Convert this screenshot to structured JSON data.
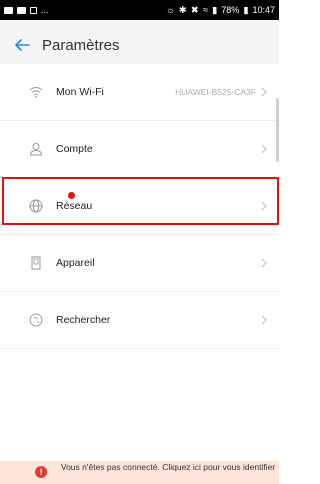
{
  "status_bar": {
    "notifications": "...",
    "battery": "78%",
    "time": "10:47"
  },
  "header": {
    "title": "Paramètres"
  },
  "list": {
    "items": [
      {
        "label": "Mon Wi-Fi",
        "value": "HUAWEI-B525-CA3F",
        "icon": "wifi-icon"
      },
      {
        "label": "Compte",
        "value": "",
        "icon": "user-icon"
      },
      {
        "label": "Réseau",
        "value": "",
        "icon": "globe-icon"
      },
      {
        "label": "Appareil",
        "value": "",
        "icon": "device-icon"
      },
      {
        "label": "Rechercher",
        "value": "",
        "icon": "search-icon"
      }
    ]
  },
  "banner": {
    "text": "Vous n'êtes pas connecté. Cliquez ici pour vous identifier"
  },
  "colors": {
    "highlight": "#e01010",
    "banner_bg": "#fbe6d9",
    "banner_icon": "#e53935"
  }
}
